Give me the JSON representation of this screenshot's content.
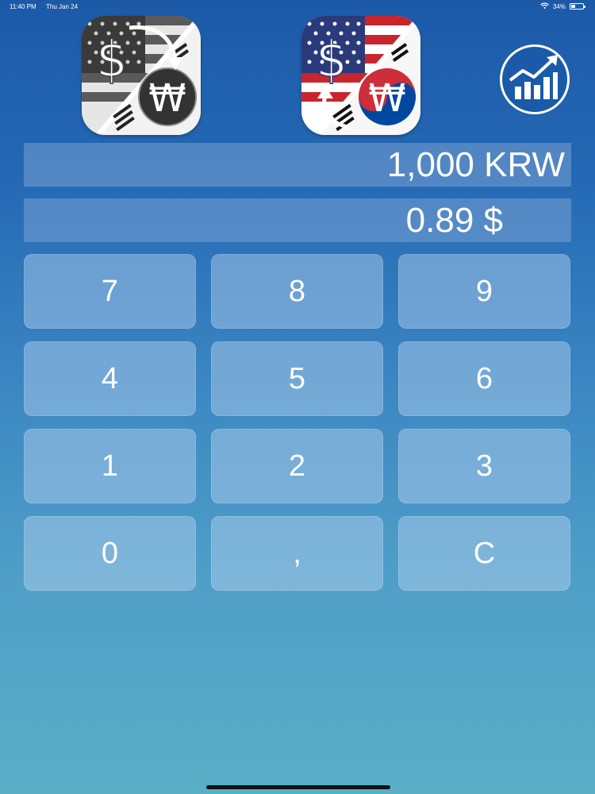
{
  "status_bar": {
    "time": "11:40 PM",
    "date": "Thu Jan 24",
    "battery": "34%",
    "battery_level": 0.34
  },
  "icons": {
    "krw_to_usd": "dollar-won-convert-icon",
    "usd_to_krw": "dollar-won-flag-icon",
    "chart": "growth-chart-icon",
    "dollar_symbol": "$",
    "won_symbol": "₩"
  },
  "display": {
    "input_value": "1,000 KRW",
    "result_value": "0.89 $"
  },
  "keypad": {
    "keys": [
      "7",
      "8",
      "9",
      "4",
      "5",
      "6",
      "1",
      "2",
      "3",
      "0",
      ",",
      "C"
    ]
  },
  "colors": {
    "background_top": "#1c5aa8",
    "background_bottom": "#5aaec6"
  }
}
